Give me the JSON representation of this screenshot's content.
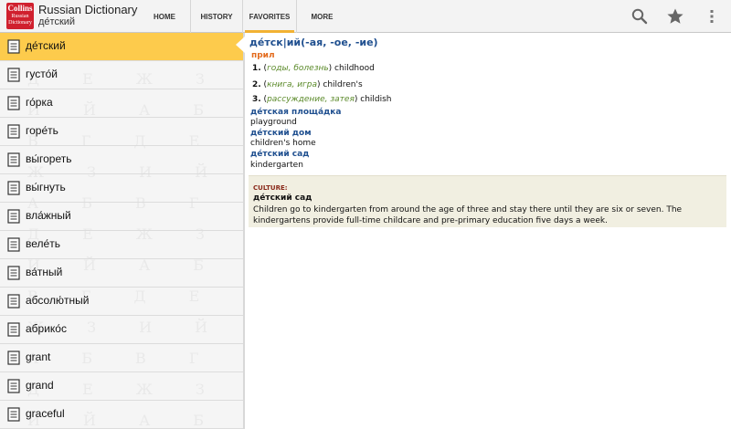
{
  "app": {
    "logo_top": "Collins",
    "logo_bottom": "Russian Dictionary",
    "title": "Russian Dictionary",
    "subtitle": "де́тский"
  },
  "tabs": [
    "HOME",
    "HISTORY",
    "FAVORITES",
    "MORE"
  ],
  "active_tab": "FAVORITES",
  "icons": [
    "search-icon",
    "star-icon",
    "overflow-menu-icon"
  ],
  "accent_color": "#fdcb4c",
  "list": [
    "де́тский",
    "густо́й",
    "го́рка",
    "горе́ть",
    "вы́гореть",
    "вы́гнуть",
    "вла́жный",
    "веле́ть",
    "ва́тный",
    "абсолю́тный",
    "абрико́с",
    "grant",
    "grand",
    "graceful"
  ],
  "entry": {
    "headword": "де́тск|ий(-ая, -ое, -ие)",
    "pos": "прил",
    "senses": [
      {
        "num": "1.",
        "gloss": "годы, болезнь",
        "translation": "childhood"
      },
      {
        "num": "2.",
        "gloss": "книга, игра",
        "translation": "children's"
      },
      {
        "num": "3.",
        "gloss": "рассуждение, затея",
        "translation": "childish"
      }
    ],
    "phrases": [
      {
        "phrase": "де́тская площа́дка",
        "translation": "playground"
      },
      {
        "phrase": "де́тский дом",
        "translation": "children's home"
      },
      {
        "phrase": "де́тский сад",
        "translation": "kindergarten"
      }
    ],
    "culture": {
      "tag": "CULTURE",
      "word": "де́тский сад",
      "text": "Children go to kindergarten from around the age of three and stay there until they are six or seven. The kindergartens provide full-time childcare and pre-primary education five days a week."
    }
  }
}
